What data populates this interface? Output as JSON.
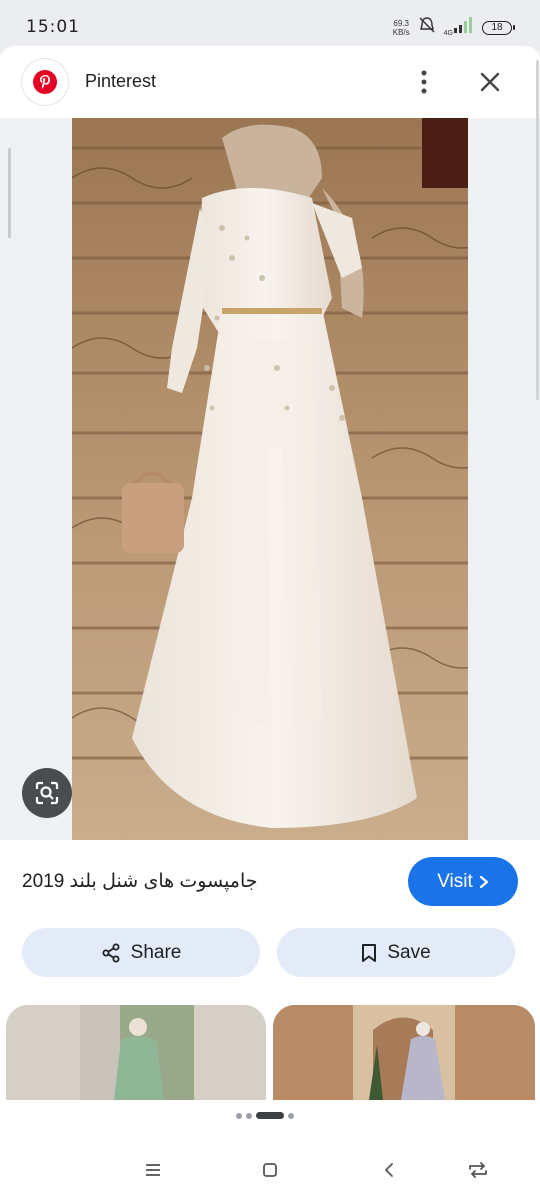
{
  "status_bar": {
    "time": "15:01",
    "net_speed_value": "69.3",
    "net_speed_unit": "KB/s",
    "network_type": "4G",
    "battery_level": "18"
  },
  "header": {
    "app_name": "Pinterest"
  },
  "pin": {
    "caption": "جامپسوت های شنل بلند 2019",
    "visit_label": "Visit",
    "share_label": "Share",
    "save_label": "Save"
  },
  "carousel": {
    "dot_count": 4,
    "active_index": 2
  },
  "colors": {
    "accent": "#1a73e8",
    "chip_bg": "#e3ebf9",
    "pinterest_red": "#e60023"
  }
}
